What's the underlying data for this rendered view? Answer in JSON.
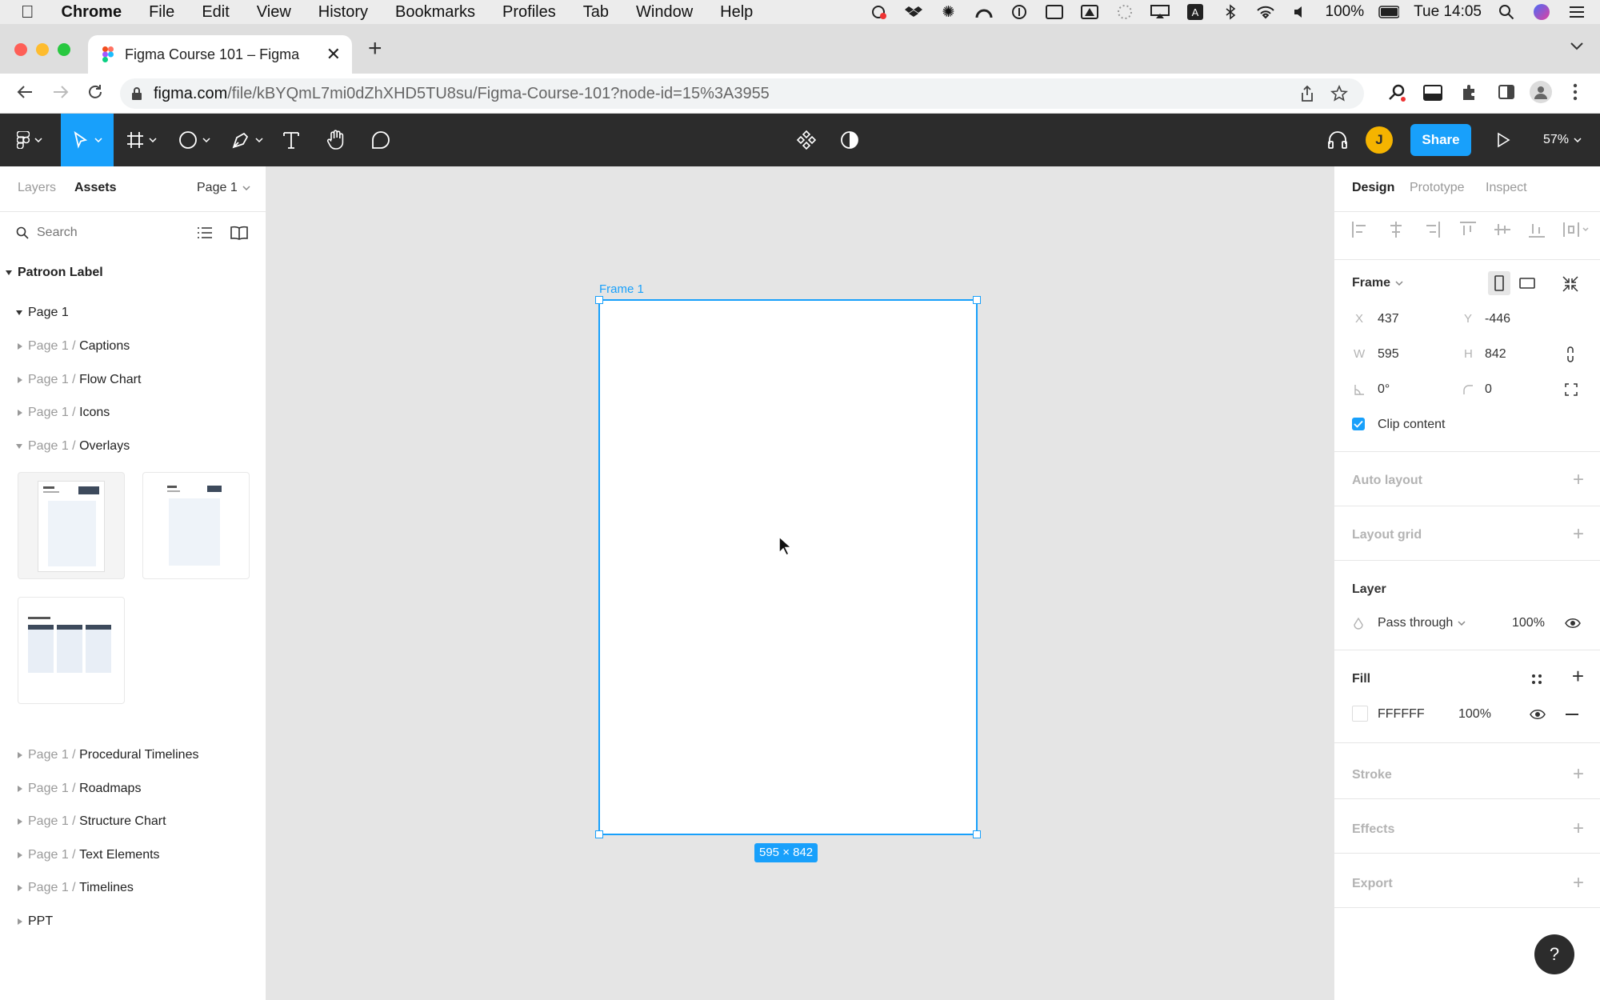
{
  "macos": {
    "app_name": "Chrome",
    "menu": [
      "File",
      "Edit",
      "View",
      "History",
      "Bookmarks",
      "Profiles",
      "Tab",
      "Window",
      "Help"
    ],
    "battery": "100%",
    "clock": "Tue 14:05"
  },
  "browser": {
    "tab_title": "Figma Course 101 – Figma",
    "url_domain": "figma.com",
    "url_path": "/file/kBYQmL7mi0dZhXHD5TU8su/Figma-Course-101?node-id=15%3A3955"
  },
  "toolbar": {
    "avatar_initial": "J",
    "share_label": "Share",
    "zoom": "57%"
  },
  "left_panel": {
    "tab_layers": "Layers",
    "tab_assets": "Assets",
    "page_selector": "Page 1",
    "search_placeholder": "Search",
    "library_name": "Patroon Label",
    "page_group": "Page 1",
    "prefix": "Page 1 /",
    "groups_top": [
      "Captions",
      "Flow Chart",
      "Icons",
      "Overlays"
    ],
    "groups_bottom": [
      "Procedural Timelines",
      "Roadmaps",
      "Structure Chart",
      "Text Elements",
      "Timelines"
    ],
    "last_group": "PPT"
  },
  "canvas": {
    "frame_name": "Frame 1",
    "size_label": "595 × 842"
  },
  "design_panel": {
    "tab_design": "Design",
    "tab_prototype": "Prototype",
    "tab_inspect": "Inspect",
    "frame_label": "Frame",
    "x_label": "X",
    "x": "437",
    "y_label": "Y",
    "y": "-446",
    "w_label": "W",
    "w": "595",
    "h_label": "H",
    "h": "842",
    "rotation": "0°",
    "radius": "0",
    "clip_content": "Clip content",
    "auto_layout": "Auto layout",
    "layout_grid": "Layout grid",
    "layer": "Layer",
    "blend_mode": "Pass through",
    "layer_opacity": "100%",
    "fill": "Fill",
    "fill_hex": "FFFFFF",
    "fill_opacity": "100%",
    "stroke": "Stroke",
    "effects": "Effects",
    "export": "Export",
    "help": "?"
  },
  "colors": {
    "accent": "#18a0fb",
    "toolbar_bg": "#2c2c2c",
    "avatar": "#f5b400"
  }
}
